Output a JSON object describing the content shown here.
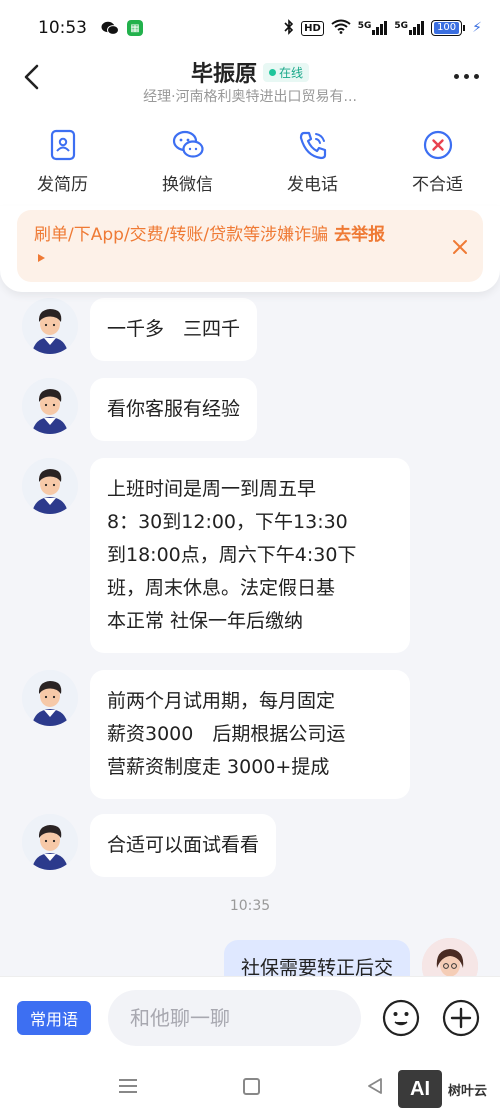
{
  "status_bar": {
    "time": "10:53",
    "network_label": "HD",
    "signal1": "5G",
    "signal2": "5G",
    "battery": "100"
  },
  "header": {
    "name": "毕振原",
    "online_label": "在线",
    "subtitle": "经理·河南格利奥特进出口贸易有..."
  },
  "actions": [
    {
      "label": "发简历",
      "icon": "resume-icon"
    },
    {
      "label": "换微信",
      "icon": "wechat-icon"
    },
    {
      "label": "发电话",
      "icon": "phone-icon"
    },
    {
      "label": "不合适",
      "icon": "reject-icon"
    }
  ],
  "warning": {
    "text": "刷单/下App/交费/转账/贷款等涉嫌诈骗",
    "link": "去举报"
  },
  "messages": [
    {
      "from": "them",
      "text": "一千多　三四千"
    },
    {
      "from": "them",
      "text": "看你客服有经验"
    },
    {
      "from": "them",
      "lines": [
        "上班时间是周一到周五早",
        "8：30到12:00，下午13:30",
        "到18:00点，周六下午4:30下",
        "班，周末休息。法定假日基",
        "本正常 社保一年后缴纳"
      ]
    },
    {
      "from": "them",
      "lines": [
        "前两个月试用期，每月固定",
        "薪资3000　后期根据公司运",
        "营薪资制度走  3000+提成"
      ]
    },
    {
      "from": "them",
      "text": "合适可以面试看看"
    },
    {
      "time": "10:35"
    },
    {
      "from": "me",
      "text": "社保需要转正后交"
    }
  ],
  "input_bar": {
    "quick_label": "常用语",
    "placeholder": "和他聊一聊"
  },
  "watermark": {
    "logo": "AI",
    "text": "树叶云"
  },
  "colors": {
    "accent": "#3d6ff2",
    "warn": "#ef7a35",
    "online": "#1fc59b"
  }
}
